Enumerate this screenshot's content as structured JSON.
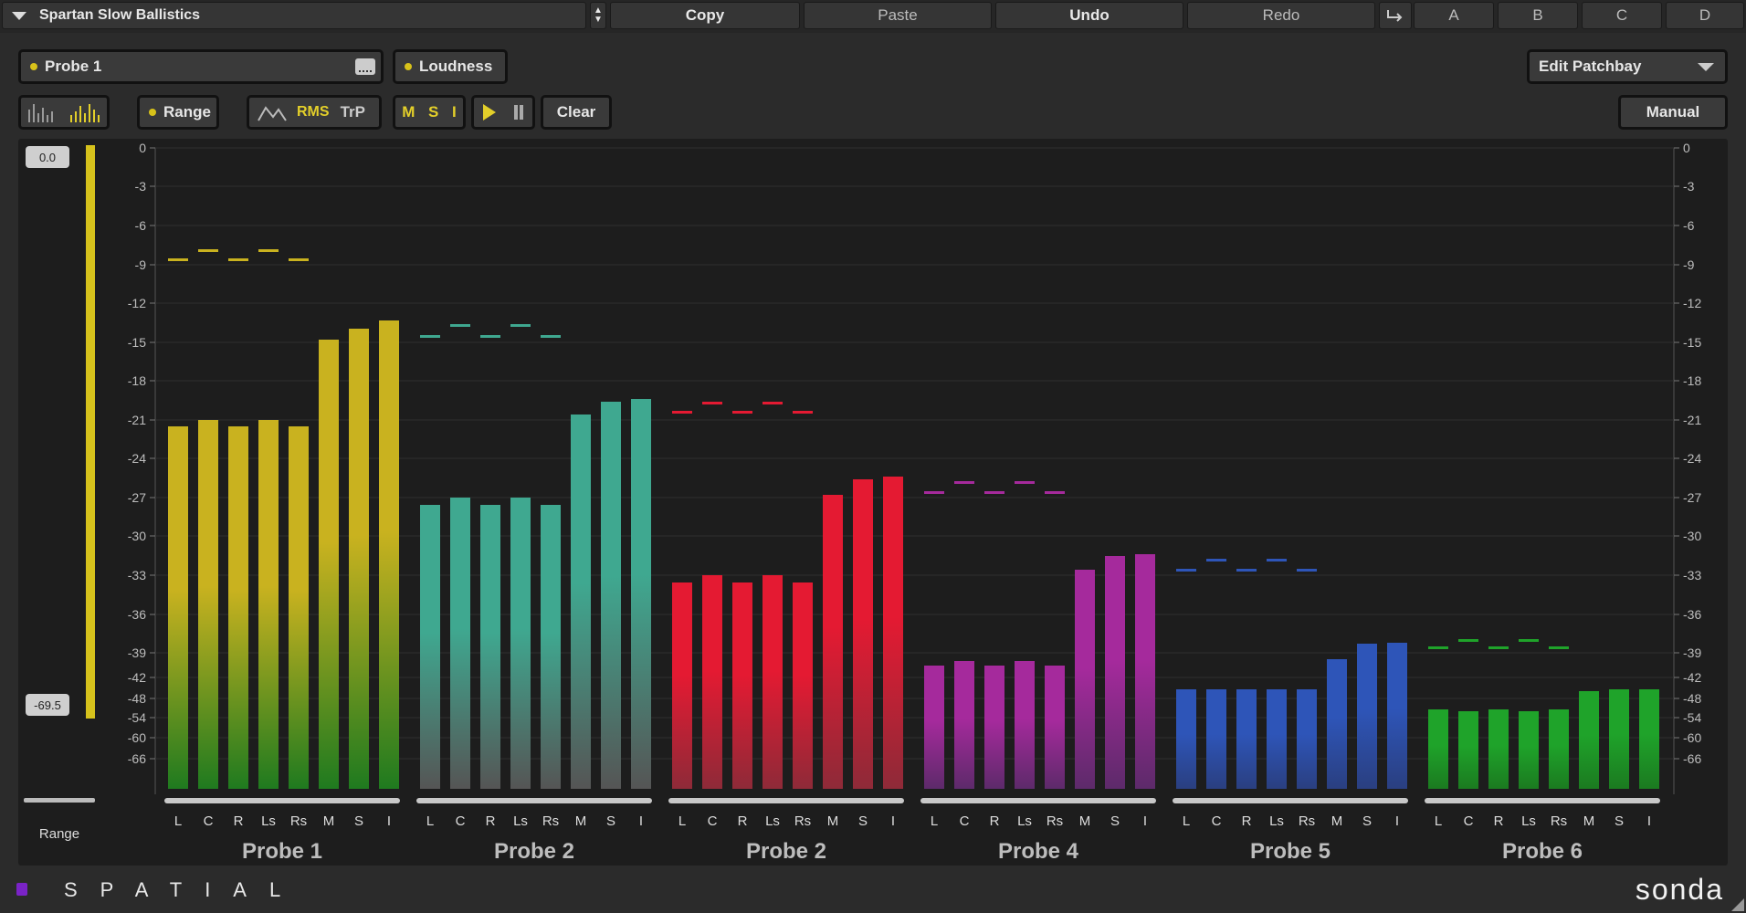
{
  "toolbar": {
    "preset": "Spartan Slow Ballistics",
    "copy": "Copy",
    "paste": "Paste",
    "undo": "Undo",
    "redo": "Redo",
    "slots": [
      "A",
      "B",
      "C",
      "D"
    ]
  },
  "controls": {
    "probe_select": "Probe 1",
    "loudness": "Loudness",
    "edit_patchbay": "Edit Patchbay",
    "range": "Range",
    "rms": "RMS",
    "trp": "TrP",
    "m": "M",
    "s": "S",
    "i": "I",
    "clear": "Clear",
    "manual": "Manual"
  },
  "range_slider": {
    "top_value": "0.0",
    "bottom_value": "-69.5",
    "label": "Range"
  },
  "chart_data": {
    "type": "bar",
    "scale_labels": [
      "0",
      "-3",
      "-6",
      "-9",
      "-12",
      "-15",
      "-18",
      "-21",
      "-24",
      "-27",
      "-30",
      "-33",
      "-36",
      "-39",
      "-42",
      "-48",
      "-54",
      "-60",
      "-66"
    ],
    "channels": [
      "L",
      "C",
      "R",
      "Ls",
      "Rs",
      "M",
      "S",
      "I"
    ],
    "series": [
      {
        "name": "Probe 1",
        "color": "#c9b21f",
        "low": "#1f7a1f",
        "values": [
          -21.5,
          -21,
          -21.5,
          -21,
          -21.5,
          -14.8,
          -14,
          -13.3
        ],
        "peaks": [
          -8.6,
          -7.9,
          -8.6,
          -7.9,
          -8.6
        ]
      },
      {
        "name": "Probe 2",
        "color": "#3fa890",
        "low": "#555555",
        "values": [
          -27.6,
          -27,
          -27.6,
          -27,
          -27.6,
          -20.6,
          -19.6,
          -19.4
        ],
        "peaks": [
          -14.5,
          -13.7,
          -14.5,
          -13.7,
          -14.5
        ]
      },
      {
        "name": "Probe 2",
        "color": "#e41a32",
        "low": "#8e2a38",
        "values": [
          -33.6,
          -33,
          -33.6,
          -33,
          -33.6,
          -26.8,
          -25.6,
          -25.4
        ],
        "peaks": [
          -20.4,
          -19.7,
          -20.4,
          -19.7,
          -20.4
        ]
      },
      {
        "name": "Probe 4",
        "color": "#a52a9c",
        "low": "#5d2a6a",
        "values": [
          -40.5,
          -40,
          -40.5,
          -40,
          -40.5,
          -32.6,
          -31.5,
          -31.4
        ],
        "peaks": [
          -26.6,
          -25.8,
          -26.6,
          -25.8,
          -26.6
        ]
      },
      {
        "name": "Probe 5",
        "color": "#2e55b8",
        "low": "#2a3f80",
        "values": [
          -45.4,
          -45.4,
          -45.4,
          -45.4,
          -45.4,
          -39.8,
          -38.3,
          -38.2
        ],
        "peaks": [
          -32.6,
          -31.8,
          -32.6,
          -31.8,
          -32.6
        ]
      },
      {
        "name": "Probe 6",
        "color": "#1fa32a",
        "low": "#1b7a20",
        "values": [
          -51.5,
          -52,
          -51.5,
          -52,
          -51.5,
          -46,
          -45.5,
          -45.5
        ],
        "peaks": [
          -38.6,
          -38,
          -38.6,
          -38,
          -38.6
        ]
      }
    ]
  },
  "footer": {
    "brand_left": "SPATIAL",
    "brand_right": "sonda"
  }
}
